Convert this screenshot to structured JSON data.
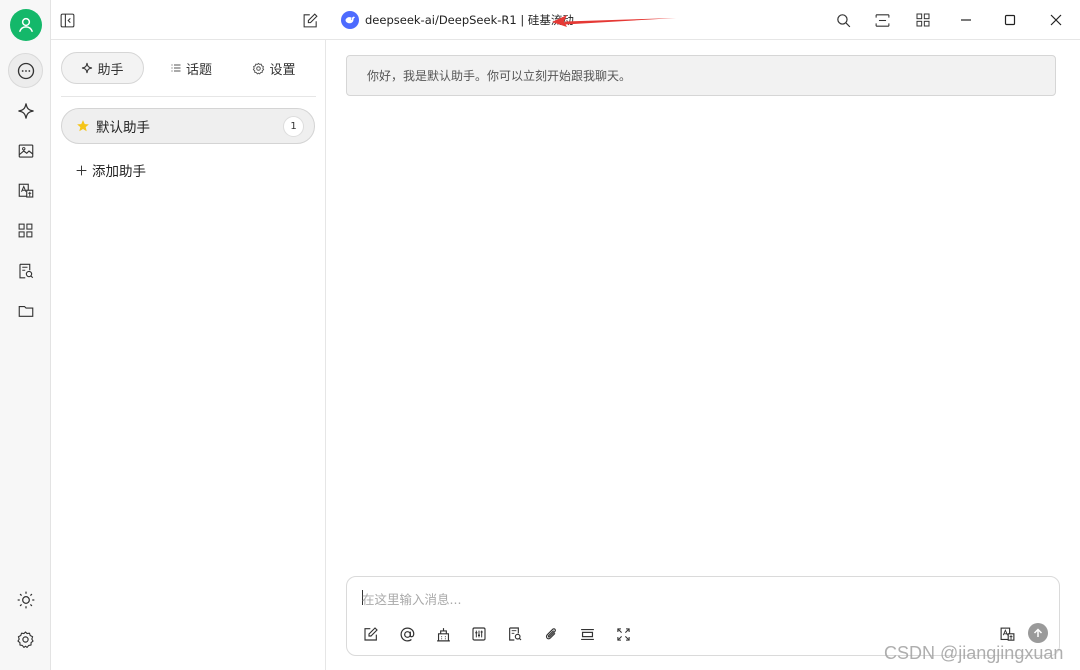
{
  "titlebar": {
    "model_name": "deepseek-ai/DeepSeek-R1 | 硅基流动"
  },
  "sidebar_tabs": [
    {
      "label": "助手",
      "icon": "sparkle-icon",
      "active": true
    },
    {
      "label": "话题",
      "icon": "list-icon",
      "active": false
    },
    {
      "label": "设置",
      "icon": "gear-icon",
      "active": false
    }
  ],
  "assistants": {
    "items": [
      {
        "name": "默认助手",
        "count": "1",
        "icon": "star-icon"
      }
    ],
    "add_label": "添加助手"
  },
  "chat": {
    "greeting": "你好，我是默认助手。你可以立刻开始跟我聊天。",
    "input_placeholder": "在这里输入消息..."
  },
  "watermark": "CSDN @jiangjingxuan",
  "colors": {
    "avatar": "#14b86a",
    "model_logo": "#4d6bfe",
    "star": "#f5c518",
    "annotation_arrow": "#e53935"
  }
}
